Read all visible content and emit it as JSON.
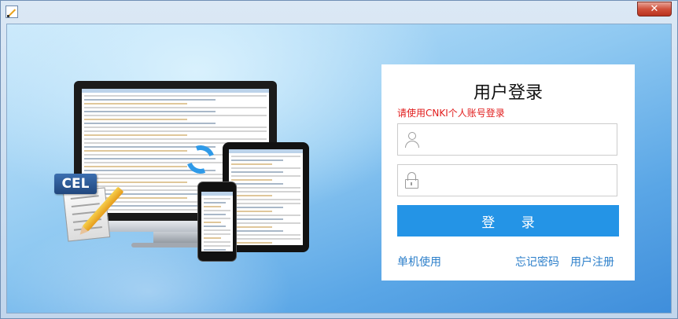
{
  "window": {
    "close_symbol": "✕",
    "app_icon": "edit-pencil-icon"
  },
  "illustration": {
    "badge_text": "CEL"
  },
  "login": {
    "title": "用户登录",
    "hint": "请使用CNKI个人账号登录",
    "username_value": "",
    "password_value": "",
    "button_label": "登 录",
    "links": {
      "offline": "单机使用",
      "forgot": "忘记密码",
      "register": "用户注册"
    }
  },
  "colors": {
    "accent": "#2494e6",
    "hint": "#e11c1c",
    "link": "#2c7fca"
  }
}
